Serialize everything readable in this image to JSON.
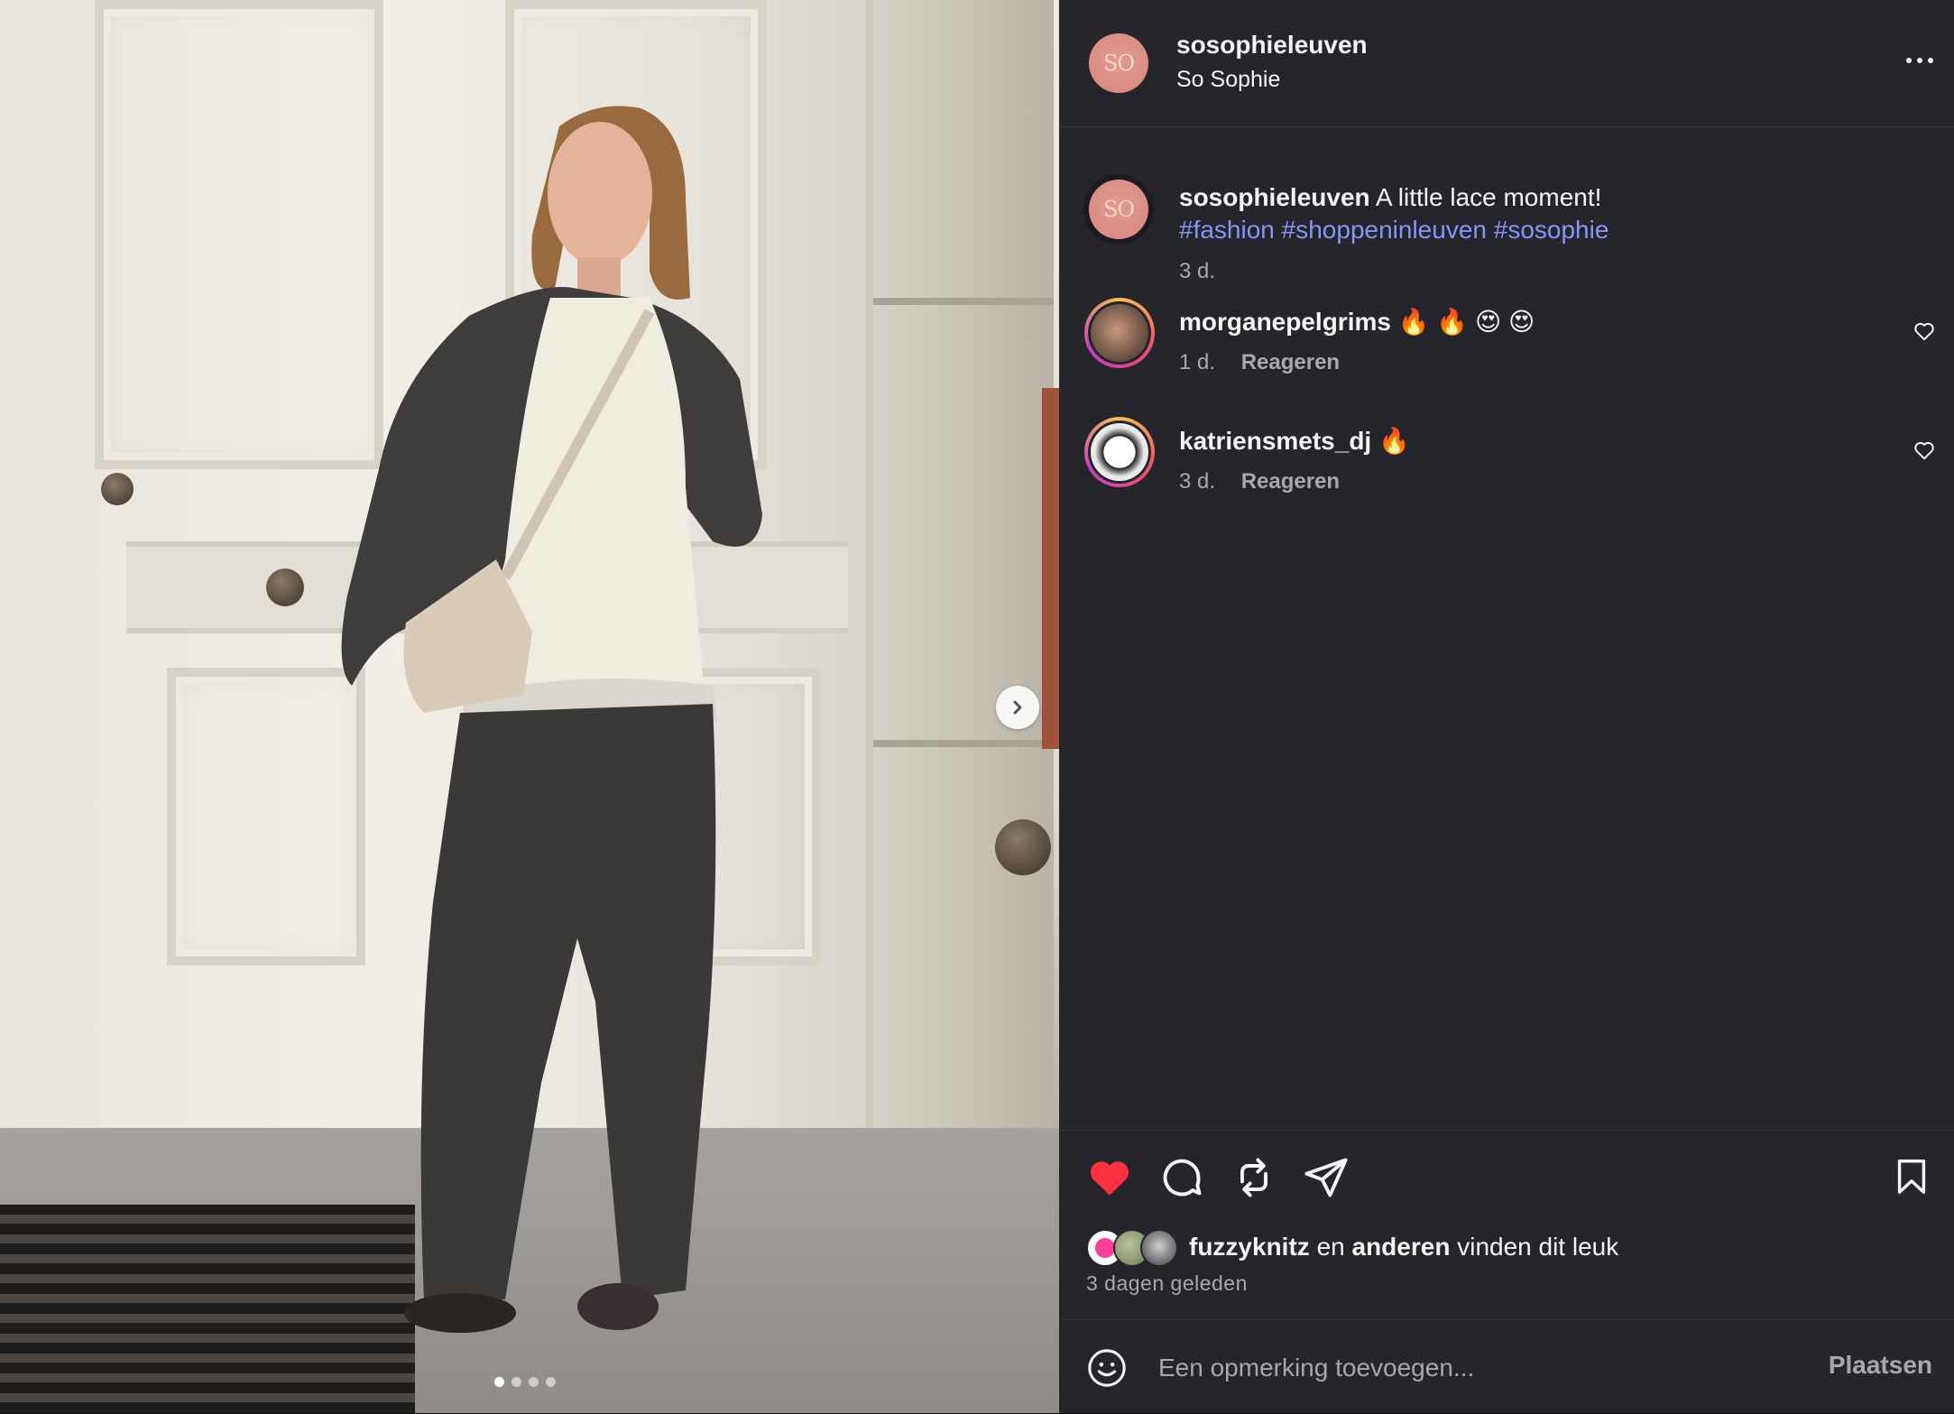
{
  "header": {
    "avatar_text": "SO",
    "username": "sosophieleuven",
    "full_name": "So Sophie"
  },
  "caption": {
    "username": "sosophieleuven",
    "text": "A little lace moment!",
    "hashtags": [
      "#fashion",
      "#shoppeninleuven",
      "#sosophie"
    ],
    "age": "3 d."
  },
  "comments": [
    {
      "username": "morganepelgrims",
      "text": "🔥 🔥 😍 😍",
      "age": "1 d.",
      "reply_label": "Reageren"
    },
    {
      "username": "katriensmets_dj",
      "text": "🔥",
      "age": "3 d.",
      "reply_label": "Reageren"
    }
  ],
  "media": {
    "carousel_count": 4,
    "carousel_active_index": 0
  },
  "actions": {
    "liked": true,
    "like_color": "#ff3040"
  },
  "likes": {
    "first_user": "fuzzyknitz",
    "connector": "en",
    "others": "anderen",
    "suffix": "vinden dit leuk",
    "date": "3 dagen geleden"
  },
  "composer": {
    "placeholder": "Een opmerking toevoegen...",
    "post_label": "Plaatsen"
  },
  "colors": {
    "panel_bg": "#25262b",
    "hashtag": "#8a93f6",
    "secondary_text": "#a8a8a8"
  }
}
